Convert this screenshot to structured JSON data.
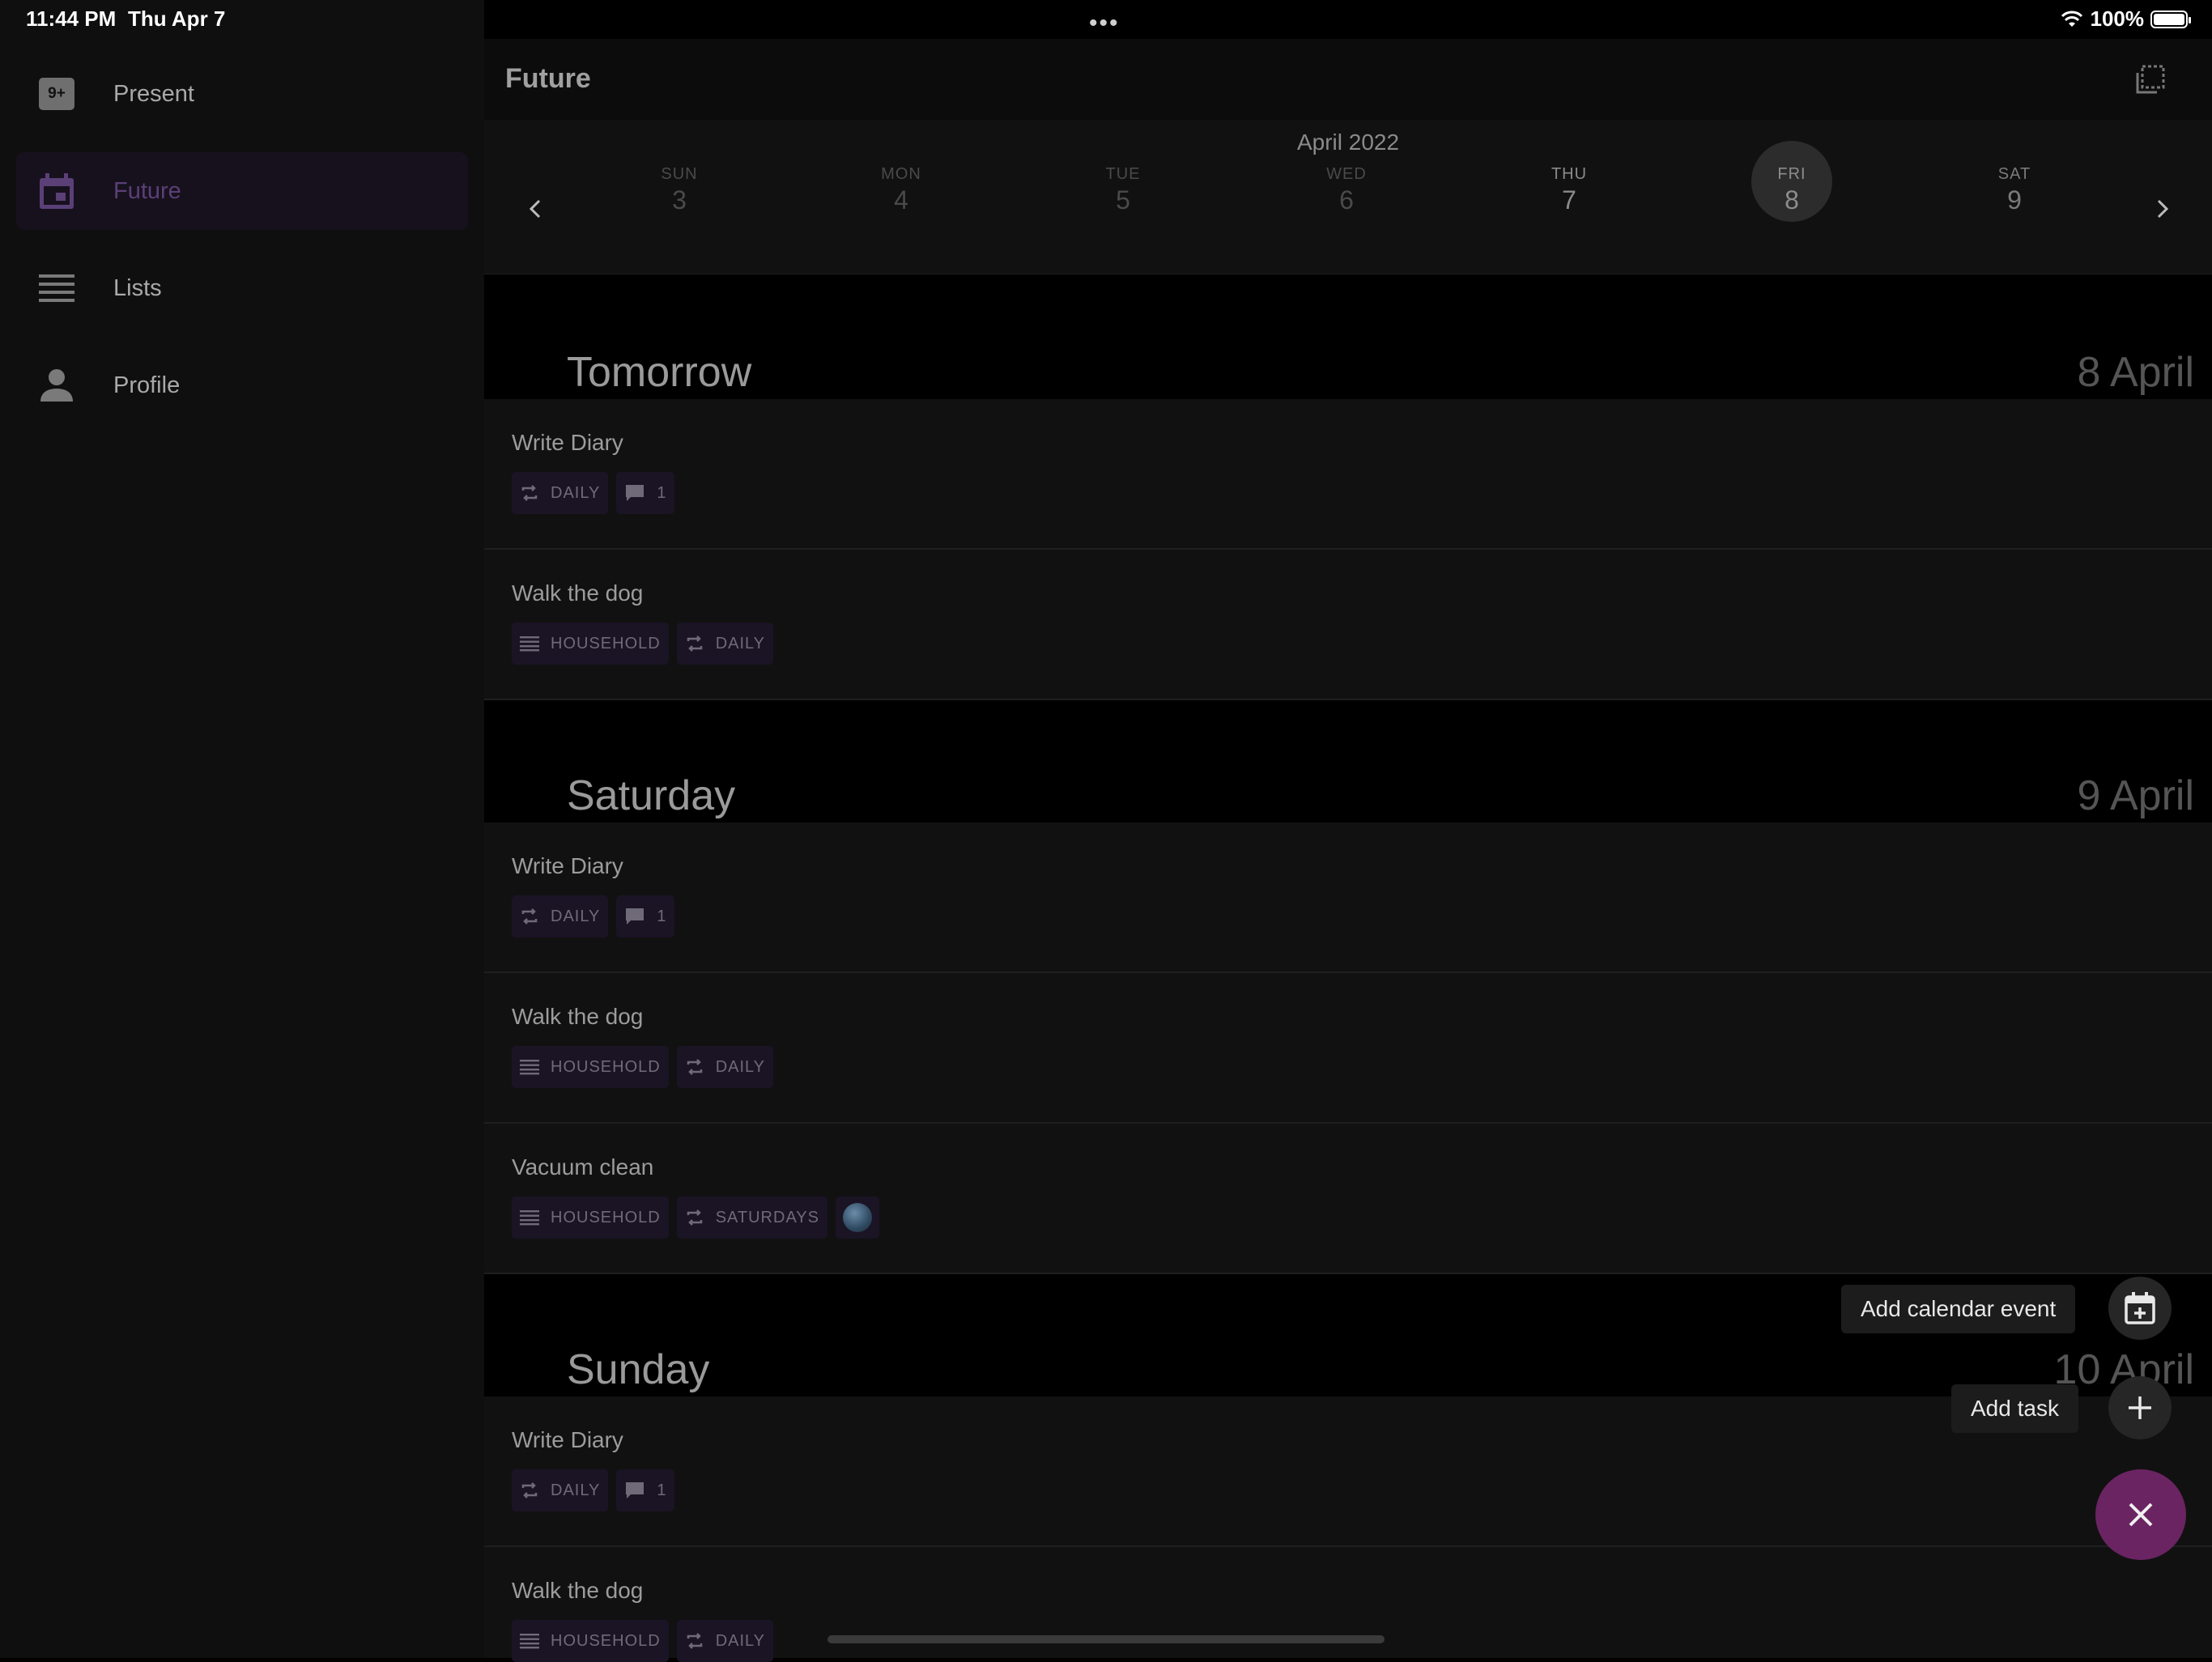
{
  "status_bar": {
    "time": "11:44 PM",
    "date": "Thu Apr 7",
    "battery": "100%"
  },
  "sidebar": {
    "badge": "9+",
    "items": [
      {
        "label": "Present",
        "icon": "present-badge-icon"
      },
      {
        "label": "Future",
        "icon": "calendar-icon",
        "active": true
      },
      {
        "label": "Lists",
        "icon": "list-icon"
      },
      {
        "label": "Profile",
        "icon": "person-icon"
      }
    ]
  },
  "header": {
    "title": "Future"
  },
  "week": {
    "month": "April 2022",
    "days": [
      {
        "name": "SUN",
        "num": "3"
      },
      {
        "name": "MON",
        "num": "4"
      },
      {
        "name": "TUE",
        "num": "5"
      },
      {
        "name": "WED",
        "num": "6"
      },
      {
        "name": "THU",
        "num": "7"
      },
      {
        "name": "FRI",
        "num": "8"
      },
      {
        "name": "SAT",
        "num": "9"
      }
    ]
  },
  "sections": [
    {
      "title": "Tomorrow",
      "date": "8 April",
      "tasks": [
        {
          "title": "Write Diary",
          "chips": {
            "repeat": "DAILY",
            "comments": "1"
          }
        },
        {
          "title": "Walk the dog",
          "chips": {
            "list": "HOUSEHOLD",
            "repeat": "DAILY"
          }
        }
      ]
    },
    {
      "title": "Saturday",
      "date": "9 April",
      "tasks": [
        {
          "title": "Write Diary",
          "chips": {
            "repeat": "DAILY",
            "comments": "1"
          }
        },
        {
          "title": "Walk the dog",
          "chips": {
            "list": "HOUSEHOLD",
            "repeat": "DAILY"
          }
        },
        {
          "title": "Vacuum clean",
          "chips": {
            "list": "HOUSEHOLD",
            "repeat": "SATURDAYS"
          }
        }
      ]
    },
    {
      "title": "Sunday",
      "date": "10 April",
      "tasks": [
        {
          "title": "Write Diary",
          "chips": {
            "repeat": "DAILY",
            "comments": "1"
          }
        },
        {
          "title": "Walk the dog",
          "chips": {
            "list": "HOUSEHOLD",
            "repeat": "DAILY"
          }
        }
      ]
    }
  ],
  "fab": {
    "add_event_label": "Add calendar event",
    "add_task_label": "Add task"
  },
  "colors": {
    "accent": "#5b3f77",
    "fab": "#6a2462",
    "chip_bg": "#1b1425"
  }
}
